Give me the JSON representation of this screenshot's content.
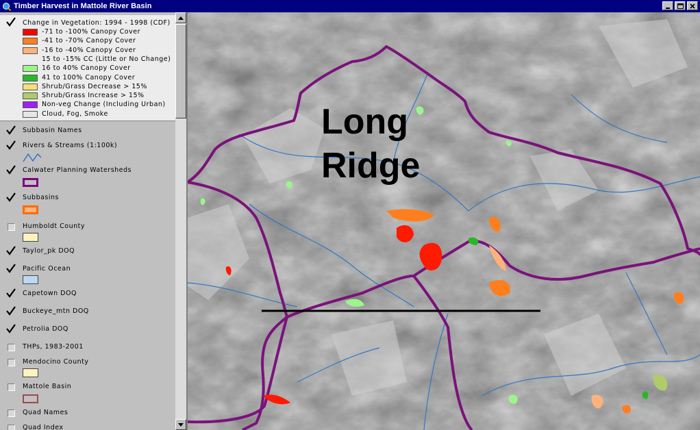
{
  "window": {
    "title": "Timber Harvest in Mattole River Basin"
  },
  "veg_legend": {
    "title": "Change in Vegetation: 1994 - 1998 (CDF)",
    "checked": true,
    "classes": [
      {
        "label": "-71 to -100% Canopy Cover",
        "color": "#ff0000"
      },
      {
        "label": "-41 to -70% Canopy Cover",
        "color": "#ff7f1f"
      },
      {
        "label": "-16 to -40% Canopy Cover",
        "color": "#ffb27a"
      },
      {
        "label": "15 to -15% CC (Little or No Change)",
        "color": ""
      },
      {
        "label": "16 to 40% Canopy Cover",
        "color": "#9cf58c"
      },
      {
        "label": "41 to 100% Canopy Cover",
        "color": "#27b827"
      },
      {
        "label": "Shrub/Grass Decrease > 15%",
        "color": "#f2e07a"
      },
      {
        "label": "Shrub/Grass Increase > 15%",
        "color": "#b0cc6a"
      },
      {
        "label": "Non-veg Change (Including Urban)",
        "color": "#a020f0"
      },
      {
        "label": "Cloud, Fog, Smoke",
        "color": "#e6e6e6"
      }
    ]
  },
  "layers": [
    {
      "label": "Subbasin Names",
      "checked": true,
      "symbol": "none"
    },
    {
      "label": "Rivers & Streams (1:100k)",
      "checked": true,
      "symbol": "line",
      "color": "#1e6ec8"
    },
    {
      "label": "Calwater Planning Watersheds",
      "checked": true,
      "symbol": "box",
      "color": "#800080"
    },
    {
      "label": "Subbasins",
      "checked": true,
      "symbol": "box",
      "color": "#ff6a00"
    },
    {
      "label": "Humboldt County",
      "checked": false,
      "symbol": "fill",
      "color": "#fff2bf"
    },
    {
      "label": "Taylor_pk DOQ",
      "checked": true,
      "symbol": "none"
    },
    {
      "label": "Pacific Ocean",
      "checked": true,
      "symbol": "fill",
      "color": "#bcd8f2"
    },
    {
      "label": "Capetown DOQ",
      "checked": true,
      "symbol": "none"
    },
    {
      "label": "Buckeye_mtn DOQ",
      "checked": true,
      "symbol": "none"
    },
    {
      "label": "Petrolia DOQ",
      "checked": true,
      "symbol": "none"
    },
    {
      "label": "THPs, 1983-2001",
      "checked": false,
      "symbol": "none"
    },
    {
      "label": "Mendocino County",
      "checked": false,
      "symbol": "fill",
      "color": "#fff2bf"
    },
    {
      "label": "Mattole Basin",
      "checked": false,
      "symbol": "box",
      "color": "#9b4a4a"
    },
    {
      "label": "Quad Names",
      "checked": false,
      "symbol": "none"
    },
    {
      "label": "Quad Index",
      "checked": false,
      "symbol": "none"
    }
  ],
  "map": {
    "annotation_line1": "Long",
    "annotation_line2": "Ridge",
    "watershed_color": "#7a127a",
    "stream_color": "#2f78c8"
  }
}
